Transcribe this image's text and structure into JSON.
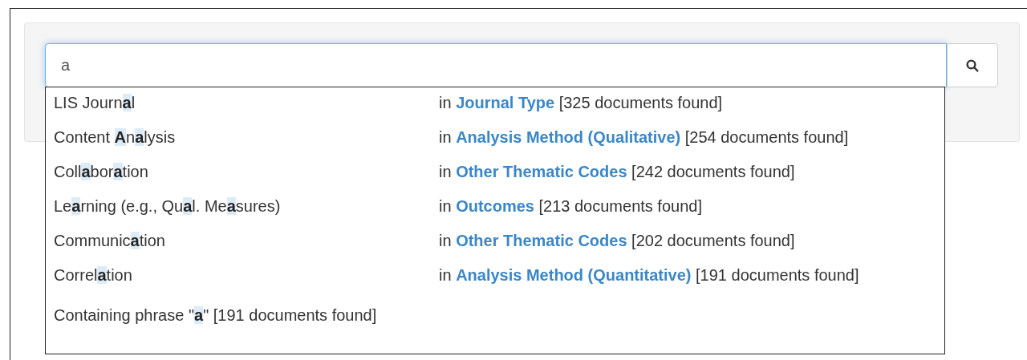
{
  "search": {
    "value": "a"
  },
  "suggestions": [
    {
      "label": "LIS Journ**a**l",
      "source": "in **Journal Type** [325 documents found]"
    },
    {
      "label": "Content **A**n**a**lysis",
      "source": "in **Analysis Method (Qualitative)** [254 documents found]"
    },
    {
      "label": "Coll**a**bor**a**tion",
      "source": "in **Other Thematic Codes** [242 documents found]"
    },
    {
      "label": "Le**a**rning (e.g., Qu**a**l. Me**a**sures)",
      "source": "in **Outcomes** [213 documents found]"
    },
    {
      "label": "Communic**a**tion",
      "source": "in **Other Thematic Codes** [202 documents found]"
    },
    {
      "label": "Correl**a**tion",
      "source": "in **Analysis Method (Quantitative)** [191 documents found]"
    }
  ],
  "phrase": "Containing phrase \"**a**\" [191 documents found]"
}
